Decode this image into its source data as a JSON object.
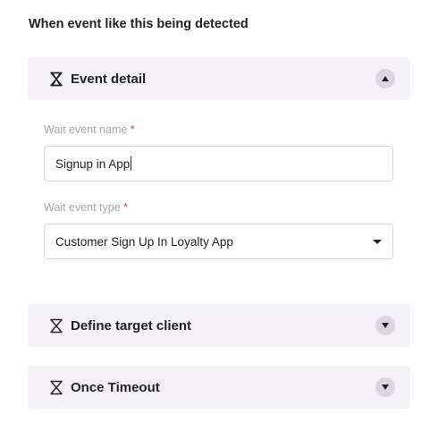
{
  "heading": "When event like this being detected",
  "panels": [
    {
      "title": "Event detail",
      "expanded": true
    },
    {
      "title": "Define target client",
      "expanded": false
    },
    {
      "title": "Once Timeout",
      "expanded": false
    }
  ],
  "form": {
    "wait_event_name": {
      "label": "Wait event name",
      "required_mark": "*",
      "value": "Signup in App"
    },
    "wait_event_type": {
      "label": "Wait event type",
      "required_mark": "*",
      "value": "Customer Sign Up In Loyalty App"
    }
  },
  "icons": {
    "panel_icon": "hourglass-icon",
    "expand": "chevron-up-icon",
    "collapse": "chevron-down-icon"
  },
  "colors": {
    "panel_bg": "#f5f2f7",
    "toggle_bg": "#dcd6e0",
    "required": "#e0393e"
  }
}
